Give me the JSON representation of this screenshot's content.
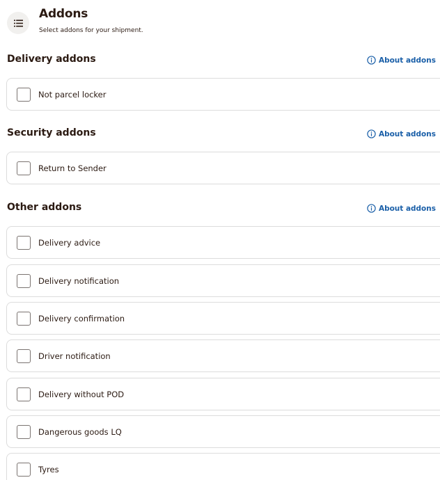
{
  "header": {
    "title": "Addons",
    "subtitle": "Select addons for your shipment.",
    "icon": "list-icon"
  },
  "sections": [
    {
      "title": "Delivery addons",
      "about_label": "About addons",
      "options": [
        {
          "label": "Not parcel locker",
          "checked": false
        }
      ]
    },
    {
      "title": "Security addons",
      "about_label": "About addons",
      "options": [
        {
          "label": "Return to Sender",
          "checked": false
        }
      ]
    },
    {
      "title": "Other addons",
      "about_label": "About addons",
      "options": [
        {
          "label": "Delivery advice",
          "checked": false
        },
        {
          "label": "Delivery notification",
          "checked": false
        },
        {
          "label": "Delivery confirmation",
          "checked": false
        },
        {
          "label": "Driver notification",
          "checked": false
        },
        {
          "label": "Delivery without POD",
          "checked": false
        },
        {
          "label": "Dangerous goods LQ",
          "checked": false
        },
        {
          "label": "Tyres",
          "checked": false
        }
      ]
    }
  ],
  "colors": {
    "heading": "#2b1a12",
    "link": "#1a5fa8",
    "border": "#dcdcdc",
    "icon_bg": "#f1f0ee"
  }
}
